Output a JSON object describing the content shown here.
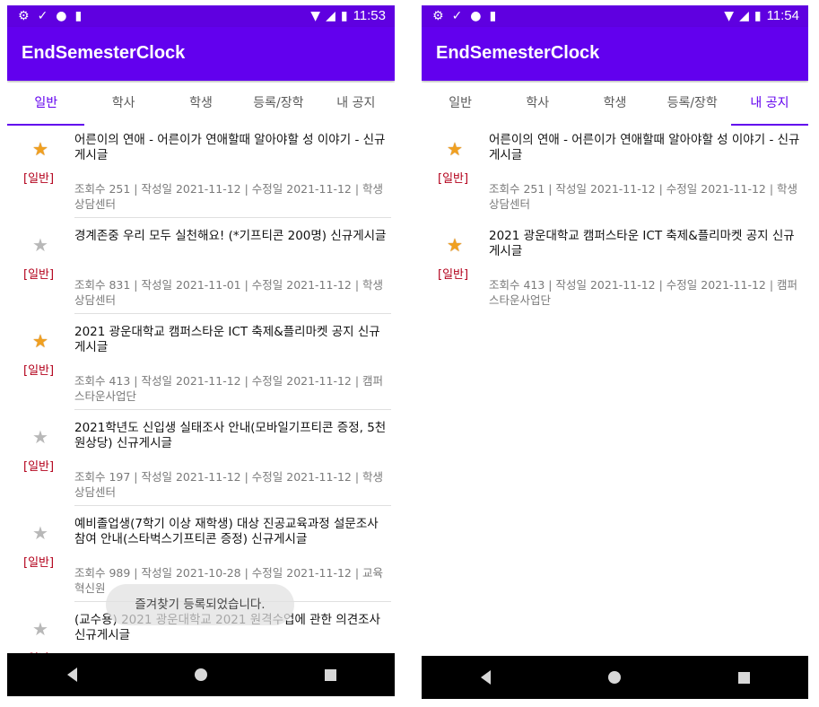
{
  "colors": {
    "primary": "#6200ee",
    "status_bar": "#5f00e0",
    "category": "#b3001b",
    "star_on": "#f0a020",
    "star_off": "#b8b8b8"
  },
  "screens": [
    {
      "status": {
        "time": "11:53"
      },
      "app_title": "EndSemesterClock",
      "tabs": [
        "일반",
        "학사",
        "학생",
        "등록/장학",
        "내 공지"
      ],
      "active_tab": "일반",
      "items": [
        {
          "starred": true,
          "category": "[일반]",
          "title": "어른이의 연애 - 어른이가 연애할때 알아야할 성 이야기 - 신규게시글",
          "meta": "조회수 251 | 작성일 2021-11-12 | 수정일 2021-11-12 | 학생상담센터"
        },
        {
          "starred": false,
          "category": "[일반]",
          "title": "경계존중 우리 모두 실천해요! (*기프티콘 200명) 신규게시글",
          "meta": "조회수 831 | 작성일 2021-11-01 | 수정일 2021-11-12 | 학생상담센터"
        },
        {
          "starred": true,
          "category": "[일반]",
          "title": "2021 광운대학교 캠퍼스타운 ICT 축제&플리마켓 공지 신규게시글",
          "meta": "조회수 413 | 작성일 2021-11-12 | 수정일 2021-11-12 | 캠퍼스타운사업단"
        },
        {
          "starred": false,
          "category": "[일반]",
          "title": "2021학년도 신입생 실태조사 안내(모바일기프티콘 증정, 5천원상당) 신규게시글",
          "meta": "조회수 197 | 작성일 2021-11-12 | 수정일 2021-11-12 | 학생상담센터"
        },
        {
          "starred": false,
          "category": "[일반]",
          "title": "예비졸업생(7학기 이상 재학생) 대상 진공교육과정 설문조사 참여 안내(스타벅스기프티콘 증정) 신규게시글",
          "meta": "조회수 989 | 작성일 2021-10-28 | 수정일 2021-11-12 | 교육혁신원"
        },
        {
          "starred": false,
          "category": "[일반]",
          "title": "(교수용) 2021 광운대학교 2021 원격수업에 관한 의견조사 신규게시글",
          "meta": ""
        }
      ],
      "toast": "즐겨찾기 등록되었습니다."
    },
    {
      "status": {
        "time": "11:54"
      },
      "app_title": "EndSemesterClock",
      "tabs": [
        "일반",
        "학사",
        "학생",
        "등록/장학",
        "내 공지"
      ],
      "active_tab": "내 공지",
      "items": [
        {
          "starred": true,
          "category": "[일반]",
          "title": "어른이의 연애 - 어른이가 연애할때 알아야할 성 이야기 - 신규게시글",
          "meta": "조회수 251 | 작성일 2021-11-12 | 수정일 2021-11-12 | 학생상담센터"
        },
        {
          "starred": true,
          "category": "[일반]",
          "title": "2021 광운대학교 캠퍼스타운 ICT 축제&플리마켓 공지 신규게시글",
          "meta": "조회수 413 | 작성일 2021-11-12 | 수정일 2021-11-12 | 캠퍼스타운사업단"
        }
      ]
    }
  ]
}
